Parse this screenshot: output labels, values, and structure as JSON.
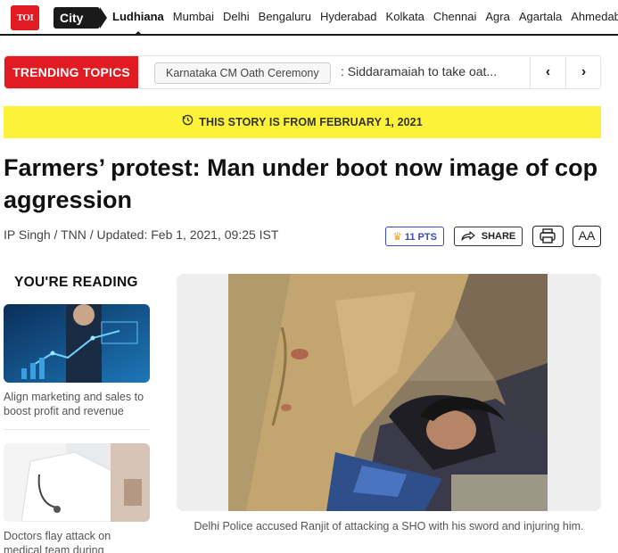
{
  "brand": {
    "logo_text": "TOI"
  },
  "nav": {
    "city_label": "City",
    "cities": [
      "Ludhiana",
      "Mumbai",
      "Delhi",
      "Bengaluru",
      "Hyderabad",
      "Kolkata",
      "Chennai",
      "Agra",
      "Agartala",
      "Ahmedabad"
    ],
    "active_city": "Ludhiana"
  },
  "trending": {
    "label": "TRENDING TOPICS",
    "chip": "Karnataka CM Oath Ceremony",
    "headline": ": Siddaramaiah to take oat...",
    "prev": "‹",
    "next": "›"
  },
  "banner": {
    "text": "THIS STORY IS FROM FEBRUARY 1, 2021"
  },
  "article": {
    "title": "Farmers’ protest: Man under boot now image of cop aggression",
    "byline": "IP Singh / TNN / Updated: Feb 1, 2021, 09:25 IST",
    "points": "11 PTS",
    "share": "SHARE",
    "text_size": "AA",
    "caption": "Delhi Police accused Ranjit of attacking a SHO with his sword and injuring him."
  },
  "sidebar": {
    "title": "YOU'RE READING",
    "items": [
      {
        "text": "Align marketing and sales to boost profit and revenue"
      },
      {
        "text": "Doctors flay attack on medical team during"
      }
    ]
  },
  "colors": {
    "brand_red": "#e21b22",
    "banner_yellow": "#fbf239",
    "points_blue": "#3b4cc0"
  }
}
